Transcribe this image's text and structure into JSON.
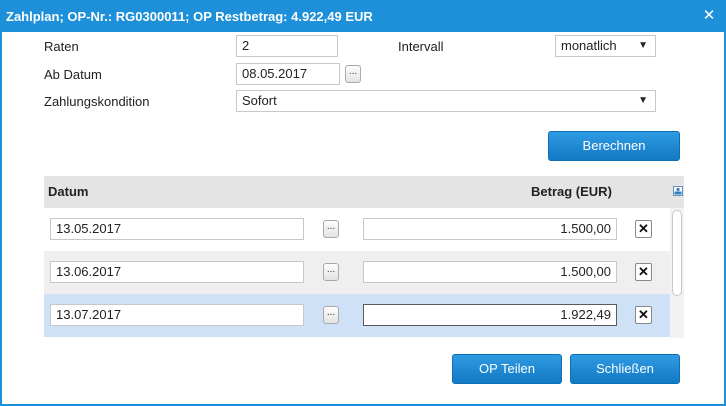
{
  "window": {
    "title": "Zahlplan; OP-Nr.: RG0300011; OP Restbetrag: 4.922,49 EUR",
    "close_glyph": "✕"
  },
  "form": {
    "raten_label": "Raten",
    "raten_value": "2",
    "intervall_label": "Intervall",
    "intervall_value": "monatlich",
    "ab_datum_label": "Ab Datum",
    "ab_datum_value": "08.05.2017",
    "zahlungskondition_label": "Zahlungskondition",
    "zahlungskondition_value": "Sofort",
    "dots_label": "...",
    "dropdown_arrow": "▼"
  },
  "buttons": {
    "berechnen": "Berechnen",
    "op_teilen": "OP Teilen",
    "schliessen": "Schließen"
  },
  "grid": {
    "col_datum": "Datum",
    "col_betrag": "Betrag (EUR)",
    "delete_glyph": "✕",
    "rows": [
      {
        "datum": "13.05.2017",
        "betrag": "1.500,00"
      },
      {
        "datum": "13.06.2017",
        "betrag": "1.500,00"
      },
      {
        "datum": "13.07.2017",
        "betrag": "1.922,49"
      }
    ]
  },
  "colors": {
    "accent": "#1e8fd9",
    "selected_row": "#cfe1f7",
    "header_bg": "#e4e4e4"
  }
}
